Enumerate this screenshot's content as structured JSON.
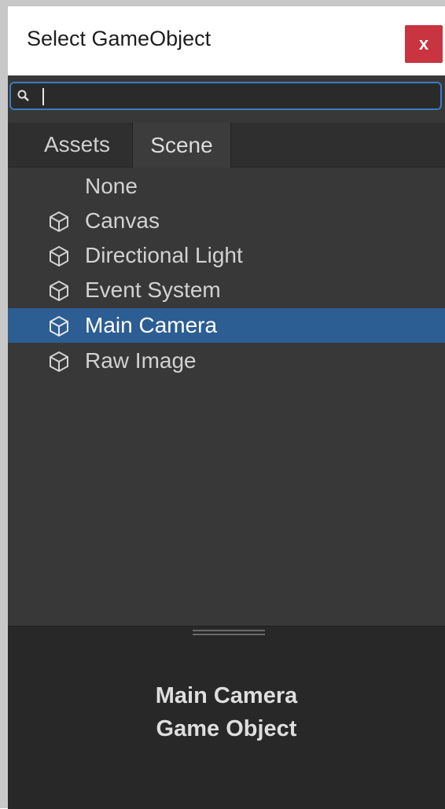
{
  "window": {
    "title": "Select GameObject",
    "close_label": "x"
  },
  "search": {
    "value": "",
    "placeholder": ""
  },
  "tabs": [
    {
      "label": "Assets",
      "active": false
    },
    {
      "label": "Scene",
      "active": true
    }
  ],
  "list": {
    "items": [
      {
        "label": "None",
        "icon": "",
        "selected": false
      },
      {
        "label": "Canvas",
        "icon": "cube-icon",
        "selected": false
      },
      {
        "label": "Directional Light",
        "icon": "cube-icon",
        "selected": false
      },
      {
        "label": "Event System",
        "icon": "cube-icon",
        "selected": false
      },
      {
        "label": "Main Camera",
        "icon": "cube-icon",
        "selected": true
      },
      {
        "label": "Raw Image",
        "icon": "cube-icon",
        "selected": false
      }
    ]
  },
  "preview": {
    "name": "Main Camera",
    "type": "Game Object"
  },
  "colors": {
    "selection": "#2c5d93",
    "close": "#c8343f",
    "search_focus": "#3d79c4",
    "panel_bg": "#383838"
  }
}
